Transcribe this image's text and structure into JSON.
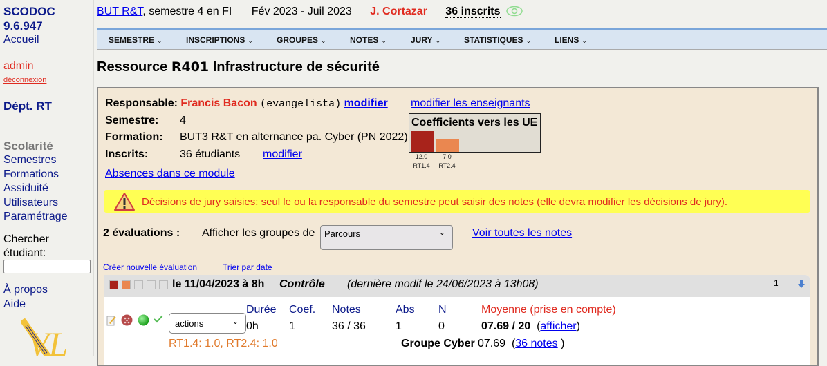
{
  "sidebar": {
    "app_name": "SCODOC",
    "version": "9.6.947",
    "home": "Accueil",
    "user": "admin",
    "logout": "déconnexion",
    "dept": "Dépt. RT",
    "section_title": "Scolarité",
    "menu": [
      "Semestres",
      "Formations",
      "Assiduité",
      "Utilisateurs",
      "Paramétrage"
    ],
    "search_label_1": "Chercher",
    "search_label_2": "étudiant:",
    "search_value": "",
    "about": "À propos",
    "help": "Aide"
  },
  "header": {
    "formation_link": "BUT R&T",
    "semester_text": ", semestre 4 en FI",
    "dates": "Fév 2023 - Juil 2023",
    "responsable": "J. Cortazar",
    "inscrits": "36 inscrits"
  },
  "navbar": {
    "items": [
      "SEMESTRE",
      "INSCRIPTIONS",
      "GROUPES",
      "NOTES",
      "JURY",
      "STATISTIQUES",
      "LIENS"
    ],
    "chevron": "⌄"
  },
  "title": {
    "prefix": "Ressource",
    "code": "R401",
    "name": "Infrastructure de sécurité"
  },
  "module": {
    "responsable_label": "Responsable:",
    "responsable_name": "Francis Bacon",
    "responsable_login": "(evangelista)",
    "modify": "modifier",
    "modify_teachers": "modifier les enseignants",
    "semestre_label": "Semestre:",
    "semestre_value": "4",
    "formation_label": "Formation:",
    "formation_value": "BUT3 R&T en alternance pa. Cyber (PN 2022)",
    "inscrits_label": "Inscrits:",
    "inscrits_value": "36 étudiants",
    "inscrits_modify": "modifier",
    "absences_link": "Absences dans ce module"
  },
  "coefficients": {
    "title": "Coefficients vers les UE",
    "items": [
      {
        "ue": "RT1.4",
        "value": 12.0,
        "label": "12.0",
        "color": "#a8231b"
      },
      {
        "ue": "RT2.4",
        "value": 7.0,
        "label": "7.0",
        "color": "#ea8750"
      }
    ]
  },
  "alert": {
    "message": "Décisions de jury saisies: seul le ou la responsable du semestre peut saisir des notes (elle devra modifier les décisions de jury)."
  },
  "evaluations": {
    "count_label": "2 évaluations :",
    "groups_label": "Afficher les groupes de",
    "groups_selected": "Parcours",
    "see_all": "Voir toutes les notes",
    "create": "Créer nouvelle évaluation",
    "sort": "Trier par date",
    "items": [
      {
        "date": "le 11/04/2023 à 8h",
        "type": "Contrôle",
        "last_modif": "(dernière modif le 24/06/2023 à 13h08)",
        "index": "1",
        "actions_selected": "actions",
        "cols": {
          "duree_h": "Durée",
          "duree": "0h",
          "coef_h": "Coef.",
          "coef": "1",
          "notes_h": "Notes",
          "notes": "36 / 36",
          "abs_h": "Abs",
          "abs": "1",
          "n_h": "N",
          "n": "0",
          "moy_h": "Moyenne (prise en compte)",
          "moy": "07.69 / 20",
          "show": "afficher"
        },
        "ue_poids": "RT1.4: 1.0, RT2.4: 1.0",
        "group_label": "Groupe Cyber",
        "group_moy": "07.69",
        "group_notes": "36 notes"
      }
    ]
  }
}
